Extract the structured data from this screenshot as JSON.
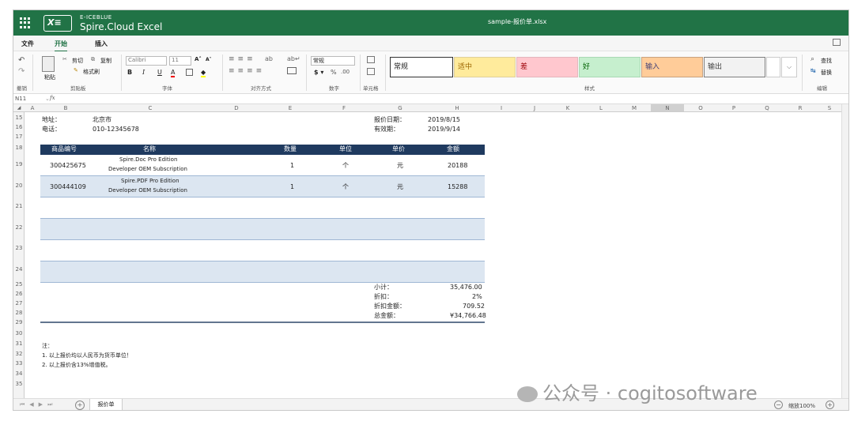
{
  "app": {
    "brand_small": "E-ICEBLUE",
    "brand": "Spire.Cloud Excel",
    "logo_text": "X≡",
    "doc_title": "sample-报价单.xlsx"
  },
  "menu": {
    "file": "文件",
    "home": "开始",
    "insert": "插入"
  },
  "ribbon": {
    "undo": "撤销",
    "paste": "粘贴",
    "cut": "剪切",
    "copy": "复制",
    "format_painter": "格式刷",
    "clipboard_group": "剪贴板",
    "font_name": "Calibri",
    "font_size": "11",
    "font_group": "字体",
    "align_group": "对齐方式",
    "number_format": "常规",
    "number_group": "数字",
    "cell_group": "单元格",
    "styles": [
      {
        "label": "常规",
        "bg": "#ffffff",
        "fg": "#222222",
        "border": "#333333"
      },
      {
        "label": "适中",
        "bg": "#ffeb9c",
        "fg": "#9c6500",
        "border": "#e0d09a"
      },
      {
        "label": "差",
        "bg": "#ffc7ce",
        "fg": "#9c0006",
        "border": "#e3b6bd"
      },
      {
        "label": "好",
        "bg": "#c6efce",
        "fg": "#006100",
        "border": "#a9d9b4"
      },
      {
        "label": "输入",
        "bg": "#ffcc99",
        "fg": "#3f3f76",
        "border": "#c9a27f"
      },
      {
        "label": "输出",
        "bg": "#f2f2f2",
        "fg": "#3f3f3f",
        "border": "#7f7f7f"
      }
    ],
    "styles_group": "样式",
    "find": "查找",
    "replace": "替换",
    "edit_group": "编辑"
  },
  "formula_bar": {
    "cell_ref": "N11",
    "fx": "fx",
    "value": ""
  },
  "columns": [
    "A",
    "B",
    "C",
    "D",
    "E",
    "F",
    "G",
    "H",
    "I",
    "J",
    "K",
    "L",
    "M",
    "N",
    "O",
    "P",
    "Q",
    "R",
    "S"
  ],
  "rows": [
    "15",
    "16",
    "17",
    "18",
    "19",
    "20",
    "21",
    "22",
    "23",
    "24",
    "25",
    "26",
    "27",
    "28",
    "29",
    "30",
    "31",
    "32",
    "33",
    "34",
    "35"
  ],
  "sheet": {
    "address_label": "地址：",
    "address_value": "北京市",
    "phone_label": "电话：",
    "phone_value": "010-12345678",
    "quote_date_label": "报价日期：",
    "quote_date_value": "2019/8/15",
    "valid_label": "有效期：",
    "valid_value": "2019/9/14",
    "headers": [
      "商品编号",
      "名称",
      "数量",
      "单位",
      "单价",
      "金额"
    ],
    "items": [
      {
        "code": "300425675",
        "name1": "Spire.Doc Pro Edition",
        "name2": "Developer OEM Subscription",
        "qty": "1",
        "unit": "个",
        "price": "元",
        "amount": "20188"
      },
      {
        "code": "300444109",
        "name1": "Spire.PDF Pro Edition",
        "name2": "Developer OEM Subscription",
        "qty": "1",
        "unit": "个",
        "price": "元",
        "amount": "15288"
      }
    ],
    "subtotal_label": "小计：",
    "subtotal_value": "35,476.00",
    "discount_label": "折扣：",
    "discount_value": "2%",
    "discount_amount_label": "折扣金额：",
    "discount_amount_value": "709.52",
    "total_label": "总金额：",
    "total_value": "¥34,766.48",
    "note_title": "注：",
    "note1": "1. 以上报价均以人民币为货币单位！",
    "note2": "2. 以上报价含13%增值税。"
  },
  "status": {
    "sheet_tab": "报价单",
    "zoom": "缩放100%"
  },
  "watermark": "公众号 · cogitosoftware",
  "colors": {
    "excel_green": "#217346",
    "header_navy": "#1f3a5f",
    "band_blue": "#dce6f1"
  }
}
